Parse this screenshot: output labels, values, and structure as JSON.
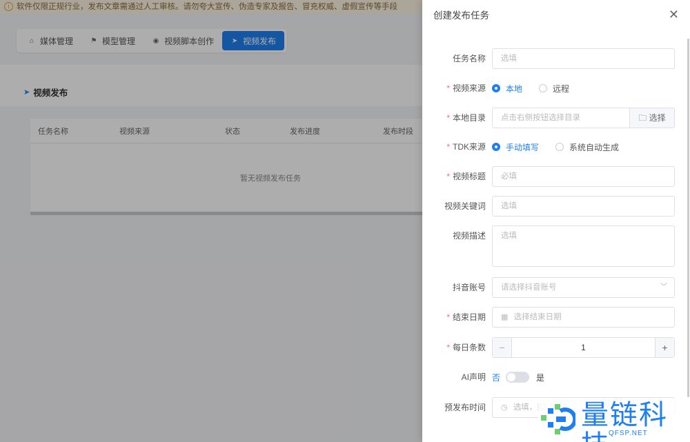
{
  "notice": {
    "text": "软件仅限正规行业，发布文章需通过人工审核。请勿夸大宣传、伪造专家及报告、冒充权威、虚假宣传等手段"
  },
  "nav_tabs": [
    {
      "label": "媒体管理",
      "icon": "home-icon",
      "glyph": "⌂"
    },
    {
      "label": "模型管理",
      "icon": "flag-icon",
      "glyph": "⚑"
    },
    {
      "label": "视频脚本创作",
      "icon": "play-circle-icon",
      "glyph": "◉"
    },
    {
      "label": "视频发布",
      "icon": "send-icon",
      "glyph": "➤"
    }
  ],
  "page": {
    "title": "视频发布"
  },
  "table": {
    "columns": [
      "任务名称",
      "视频来源",
      "状态",
      "发布进度",
      "发布时段"
    ],
    "empty_text": "暂无视频发布任务"
  },
  "drawer": {
    "title": "创建发布任务",
    "fields": {
      "task_name": {
        "label": "任务名称",
        "placeholder": "选填"
      },
      "video_source": {
        "label": "视频来源",
        "options": [
          "本地",
          "远程"
        ],
        "selected": "本地"
      },
      "local_dir": {
        "label": "本地目录",
        "placeholder": "点击右侧按钮选择目录",
        "button": "选择"
      },
      "tdk_source": {
        "label": "TDK来源",
        "options": [
          "手动填写",
          "系统自动生成"
        ],
        "selected": "手动填写"
      },
      "video_title": {
        "label": "视频标题",
        "placeholder": "必填"
      },
      "video_keywords": {
        "label": "视频关键词",
        "placeholder": "选填"
      },
      "video_desc": {
        "label": "视频描述",
        "placeholder": "选填"
      },
      "douyin_account": {
        "label": "抖音账号",
        "placeholder": "请选择抖音账号"
      },
      "end_date": {
        "label": "结束日期",
        "placeholder": "选择结束日期"
      },
      "daily_count": {
        "label": "每日条数",
        "value": "1"
      },
      "ai_statement": {
        "label": "AI声明",
        "off_label": "否",
        "on_label": "是"
      },
      "pre_publish_time": {
        "label": "预发布时间",
        "placeholder": "选填，如"
      }
    }
  },
  "watermark": {
    "text": "量链科技",
    "url": "QFSP.NET"
  },
  "colors": {
    "accent": "#1f7ff0",
    "required": "#f56c6c"
  }
}
